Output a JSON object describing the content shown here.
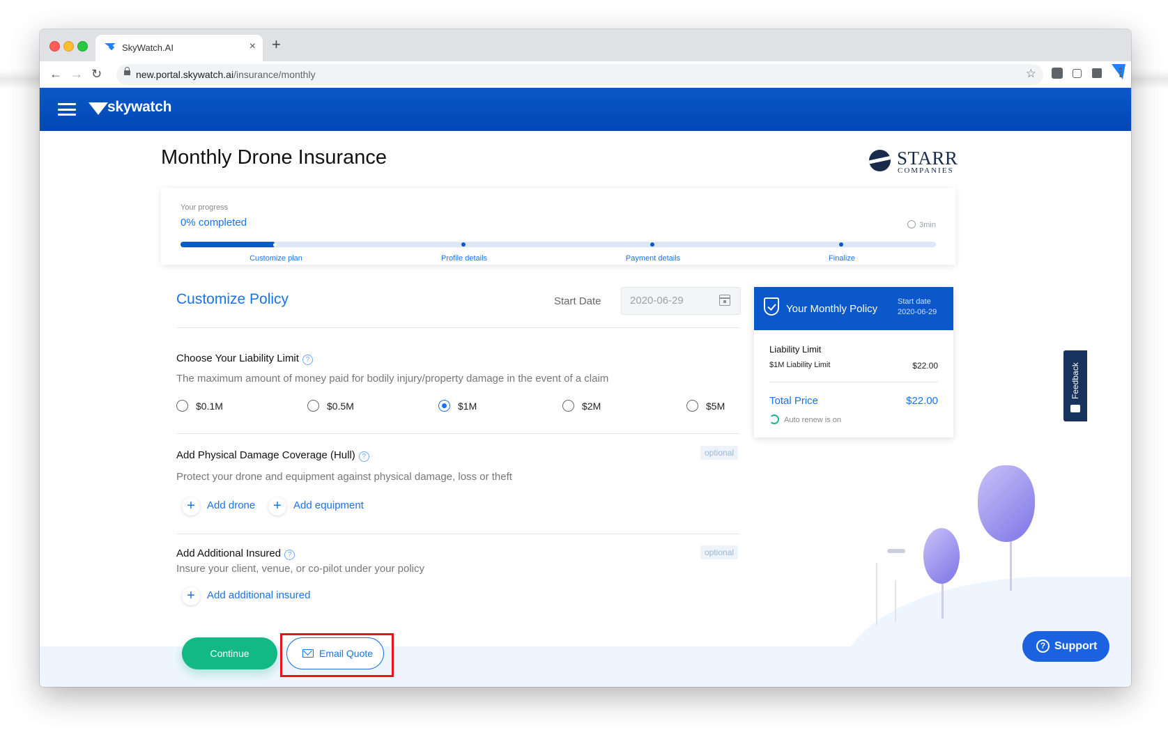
{
  "browser": {
    "tab_title": "SkyWatch.AI",
    "tab_close": "×",
    "new_tab": "+",
    "url_host": "new.portal.skywatch.ai",
    "url_path": "/insurance/monthly"
  },
  "header": {
    "logo_text": "skywatch"
  },
  "page": {
    "title": "Monthly Drone Insurance",
    "partner_logo": {
      "name": "STARR",
      "sub": "COMPANIES"
    }
  },
  "progress": {
    "label": "Your progress",
    "percent_text": "0% completed",
    "time_estimate": "3min",
    "fill_fraction": 0.125,
    "steps": [
      {
        "label": "Customize plan"
      },
      {
        "label": "Profile details"
      },
      {
        "label": "Payment details"
      },
      {
        "label": "Finalize"
      }
    ]
  },
  "customize": {
    "title": "Customize Policy",
    "start_date_label": "Start Date",
    "start_date_value": "2020-06-29",
    "liability": {
      "title": "Choose Your Liability Limit",
      "description": "The maximum amount of money paid for bodily injury/property damage in the event of a claim",
      "options": [
        "$0.1M",
        "$0.5M",
        "$1M",
        "$2M",
        "$5M"
      ],
      "selected": "$1M"
    },
    "hull": {
      "title": "Add Physical Damage Coverage (Hull)",
      "badge": "optional",
      "description": "Protect your drone and equipment against physical damage, loss or theft",
      "add_drone": "Add drone",
      "add_equipment": "Add equipment"
    },
    "additional_insured": {
      "title": "Add Additional Insured",
      "badge": "optional",
      "description": "Insure your client, venue, or co-pilot under your policy",
      "add_label": "Add additional insured"
    },
    "continue_label": "Continue",
    "email_quote_label": "Email Quote"
  },
  "policy_summary": {
    "title": "Your Monthly Policy",
    "start_date_label": "Start date",
    "start_date_value": "2020-06-29",
    "liability_title": "Liability Limit",
    "liability_item": "$1M Liability Limit",
    "liability_amount": "$22.00",
    "total_label": "Total Price",
    "total_amount": "$22.00",
    "auto_renew": "Auto renew is on"
  },
  "feedback_label": "Feedback",
  "support_label": "Support",
  "colors": {
    "brand_blue": "#0a58c9",
    "accent_blue": "#1a73e8",
    "continue_green": "#13b985",
    "highlight_red": "#e8141a"
  }
}
